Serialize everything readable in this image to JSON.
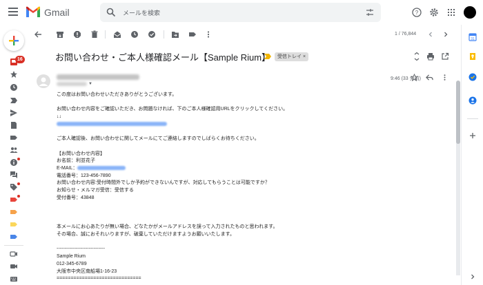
{
  "app": {
    "name": "Gmail",
    "brand_colors": {
      "red": "#EA4335",
      "blue": "#4285F4",
      "green": "#34A853",
      "yellow": "#FBBC04"
    }
  },
  "search": {
    "placeholder": "メールを検索"
  },
  "rail": {
    "inbox_count": "16",
    "icons": [
      "inbox-icon",
      "star-icon",
      "clock-icon",
      "important-icon",
      "send-icon",
      "draft-icon",
      "label-icon",
      "contacts-icon",
      "info-icon",
      "forum-icon",
      "tag-icon",
      "label-red-icon",
      "label-orange-icon",
      "label-yellow-icon",
      "label-blue-icon",
      "meet-icon",
      "video-icon",
      "keyboard-icon"
    ]
  },
  "toolbar": {
    "counter": "1 / 76,844"
  },
  "message": {
    "subject": "お問い合わせ・ご本人様確認メール【Sample Rium】",
    "label": "受信トレイ ×",
    "time": "9:46 (33 分前)",
    "body_lines": [
      "この度はお問い合わせいただきありがとうございます。",
      "",
      "お問い合わせ内容をご確認いただき、お問題なければ、下のご本人様確認用URLをクリックしてください。",
      "↓↓",
      "[link]",
      "",
      "ご本人確認後、お問い合わせに関してメールにてご連絡しますのでしばらくお待ちください。",
      "",
      "【お問い合わせ内容】",
      "お名前：利並花子",
      "E-MAIL：[email]",
      "電話番号：123-456-7890",
      "お問い合わせ内容:受付時間外でしか予約ができないんですが、対応してもらうことは可能ですか？",
      "お知らせ・メルマガ受信：受信する",
      "受付番号：43848",
      "",
      "",
      "",
      "本メールにお心あたりが無い場合、どなたかがメールアドレスを誤って入力されたものと思われます。",
      "その場合、誠におそれいりますが、破棄していただけますようお願いいたします。",
      "",
      "------------------------------",
      "Sample Rium",
      "012-345-6789",
      "大阪市中央区南船場1-16-23",
      "=============================="
    ]
  }
}
